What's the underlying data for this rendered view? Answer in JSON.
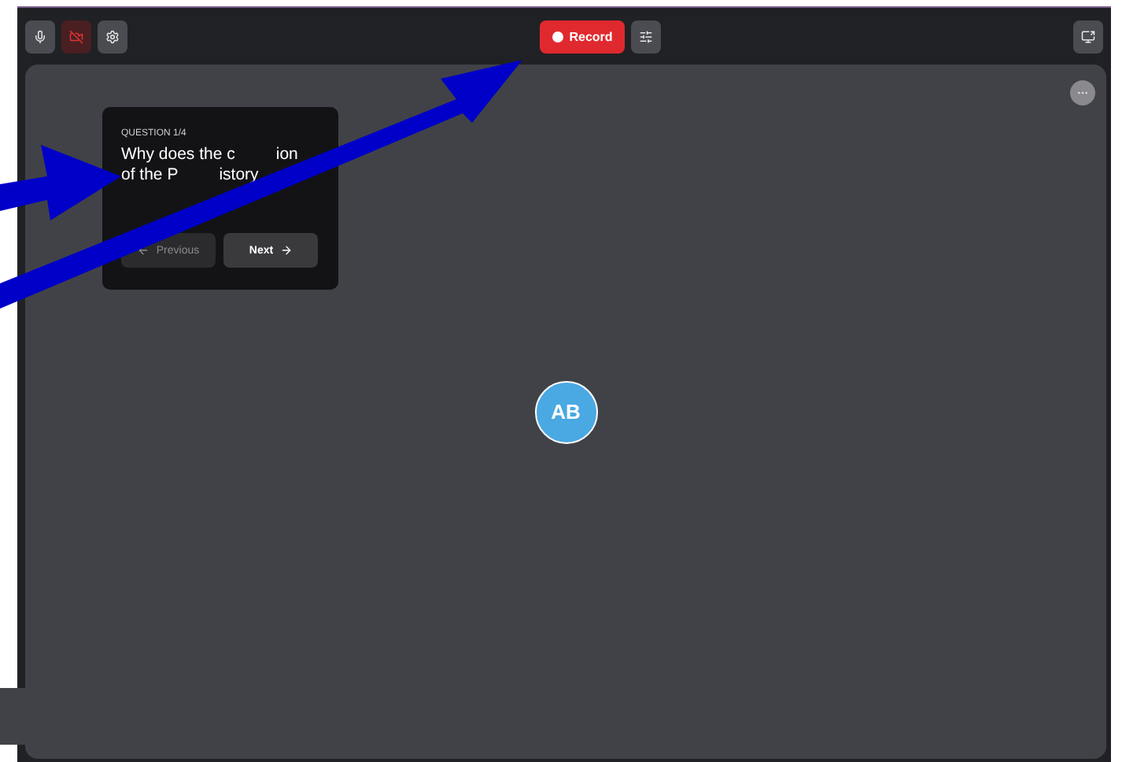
{
  "toolbar": {
    "left_buttons": [
      {
        "kind": "mic",
        "danger": false
      },
      {
        "kind": "camera-off",
        "danger": true
      },
      {
        "kind": "settings",
        "danger": false
      }
    ],
    "record_button": {
      "label": "Record"
    },
    "right_button": {
      "kind": "present"
    }
  },
  "question_card": {
    "counter": "QUESTION 1/4",
    "lines": [
      [
        "Why does the c",
        "ion"
      ],
      [
        "of the P",
        "istory"
      ]
    ],
    "buttons": [
      {
        "label": "Previous",
        "disabled": true,
        "kind": "back"
      },
      {
        "label": "Next",
        "disabled": false,
        "kind": "forward"
      }
    ]
  },
  "participant": {
    "initials": "AB",
    "color": "#4aa8e2"
  },
  "annotations": [
    {
      "kind": "arrow"
    },
    {
      "kind": "arrow"
    }
  ]
}
